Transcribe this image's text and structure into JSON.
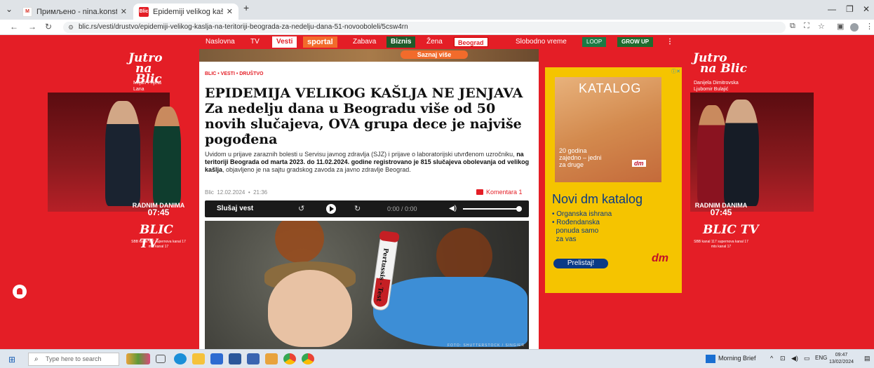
{
  "browser": {
    "tabs": [
      {
        "title": "Примљено - nina.konstantinovic",
        "favicon": "gmail-icon",
        "active": false
      },
      {
        "title": "Epidemiji velikog kašlja na teritoriji",
        "favicon": "blic-icon",
        "active": true
      }
    ],
    "url": "blic.rs/vesti/drustvo/epidemiji-velikog-kaslja-na-teritoriji-beograda-za-nedelju-dana-51-novooboleli/5csw4rn"
  },
  "site_nav": {
    "items": [
      "Naslovna",
      "TV",
      "Vesti",
      "sportal",
      "Zabava",
      "Biznis",
      "Žena",
      "Beograd",
      "Slobodno vreme",
      "LOOP",
      "GROW UP"
    ],
    "more": "⋮"
  },
  "top_banner": {
    "button": "Saznaj više"
  },
  "left_ad": {
    "logo_line1": "Jutro",
    "logo_line2": "na Blic",
    "hosts": "Miljan Prljeta\nLana Bogdanović",
    "radnim": "RADNIM DANIMA",
    "time": "07:45",
    "tv_logo": "BLIC TV",
    "channels": "SBB kanal 117   supernova kanal 17   mts kanal 17"
  },
  "right_side_ad": {
    "logo_line1": "Jutro",
    "logo_line2": "na Blic",
    "hosts": "Danijela Dimitrovska\nLjubomir Bulajić",
    "radnim": "RADNIM DANIMA",
    "time": "07:45",
    "tv_logo": "BLIC TV",
    "channels": "SBB kanal 117   supernova kanal 17   mts kanal 17"
  },
  "article": {
    "breadcrumb": "BLIC • VESTI • DRUŠTVO",
    "headline": "EPIDEMIJA VELIKOG KAŠLJA NE JENJAVA Za nedelju dana u Beogradu više od 50 novih slučajeva, OVA grupa dece je najviše pogođena",
    "lead_part1": "Uvidom u prijave zaraznih bolesti u Servisu javnog zdravlja (SJZ) i prijave o laboratorijski utvrđenom uzročniku, ",
    "lead_bold1": "na teritoriji Beograda od marta 2023. do 11.02.2024. godine registrovano je 815 slučajeva obolevanja od velikog kašlja",
    "lead_part2": ", objavljeno je na sajtu gradskog zavoda za javno zdravlje Beograd.",
    "source": "Blic",
    "date": "12.02.2024",
    "time": "21:36",
    "comments": "Komentara 1",
    "player_label": "Slušaj vest",
    "player_time": "0:00 / 0:00",
    "tube_label": "Pertussis - Test",
    "photo_credit": "FOTO: SHUTTERSTOCK / SINGIER"
  },
  "dm_ad": {
    "katalog": "KATALOG",
    "godina": "20 godina\nzajedno – jedni\nza druge",
    "title": "Novi dm katalog",
    "bullets": [
      "• Organska ishrana",
      "• Rođendanska",
      "  ponuda samo",
      "  za vas"
    ],
    "cta": "Prelistaj!",
    "logo": "dm"
  },
  "taskbar": {
    "search_placeholder": "Type here to search",
    "news": "Morning Brief",
    "lang": "ENG",
    "clock_time": "09:47",
    "clock_date": "13/02/2024"
  },
  "colors": {
    "brand_red": "#e41e26",
    "dm_yellow": "#f5c400",
    "dm_blue": "#0a3a86"
  }
}
